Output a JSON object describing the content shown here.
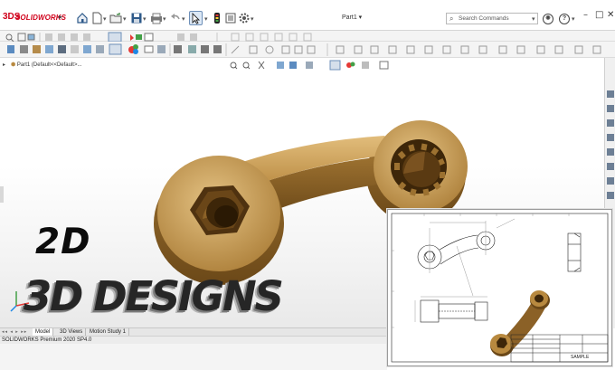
{
  "app": {
    "brand_prefix": "3DS",
    "brand_name": "SOLIDWORKS",
    "document_title": "Part1",
    "search_placeholder": "Search Commands",
    "help_label": "?",
    "window_controls": [
      "–",
      "□",
      "✕"
    ]
  },
  "toolbar_icons": [
    "home-icon",
    "new-icon",
    "open-icon",
    "save-icon",
    "print-icon",
    "undo-icon",
    "select-icon",
    "rebuild-icon",
    "file-properties-icon",
    "options-icon"
  ],
  "feature_tree": {
    "root_label": "Part1  (Default<<Default>..."
  },
  "overlay": {
    "line1": "2D",
    "line2": "3D DESIGNS"
  },
  "tabs": [
    "Model",
    "3D Views",
    "Motion Study 1"
  ],
  "active_tab": "Model",
  "status": {
    "version": "SOLIDWORKS Premium 2020 SP4.0"
  },
  "drawing_sheet": {
    "title_block_text": "SAMPLE"
  },
  "colors": {
    "brand_red": "#d0021b",
    "part_bronze": "#b8893f",
    "part_dark": "#5a3a12"
  }
}
